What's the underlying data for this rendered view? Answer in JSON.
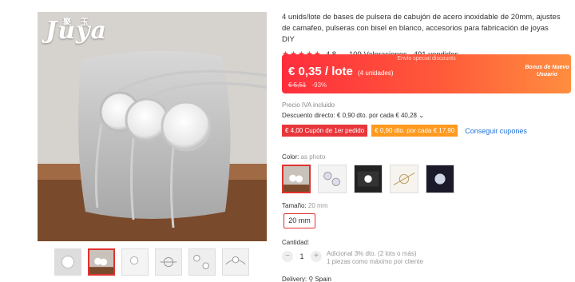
{
  "gallery": {
    "logo_text": "Juya",
    "logo_small": "聚 玉",
    "thumbnail_count": 6,
    "active_thumbnail": 2
  },
  "product": {
    "title": "4 unids/lote de bases de pulsera de cabujón de acero inoxidable de 20mm, ajustes de camafeo, pulseras con bisel en blanco, accesorios para fabricación de joyas DIY",
    "stars": "★★★★★",
    "rating": "4.8",
    "reviews": "109 Valoraciones",
    "sold": "491 vendidos"
  },
  "price": {
    "banner_label": "Envío special discounts",
    "current": "€ 0,35 / lote",
    "unit_note": "(4 unidades)",
    "original": "€ 5,51",
    "discount_pct": "-93%",
    "bonus": "Bonus de Nuevo Usuario"
  },
  "tax": {
    "vat_text": "Precio IVA incluido"
  },
  "discount": {
    "text": "Descuento directo: € 0,90 dto. por cada € 40,28"
  },
  "coupons": {
    "first": "€ 4,00 Cupón de 1er pedido",
    "second": "€ 0,90 dto. por cada € 17,90",
    "get_label": "Conseguir cupones"
  },
  "color": {
    "label": "Color:",
    "value": "as photo"
  },
  "size": {
    "label": "Tamaño:",
    "value": "20 mm",
    "option": "20 mm"
  },
  "quantity": {
    "label": "Cantidad:",
    "value": "1",
    "minus": "−",
    "plus": "+",
    "info_line1": "Adicional 3% dto. (2 lots o más)",
    "info_line2": "1 piezas como máximo por cliente"
  },
  "delivery": {
    "label": "Delivery:",
    "value": "Spain"
  },
  "colors": {
    "accent": "#e0322f",
    "link": "#1e6fd6"
  }
}
